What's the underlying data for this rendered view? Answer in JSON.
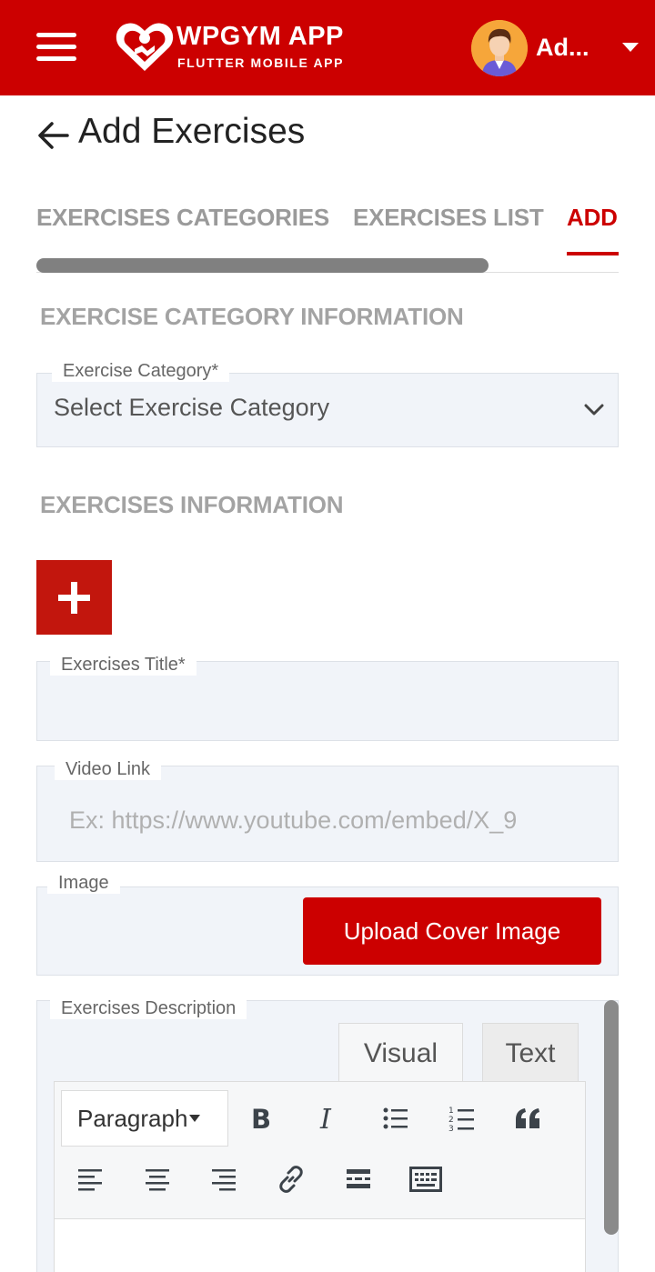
{
  "header": {
    "app_name": "WPGYM APP",
    "app_subtitle": "FLUTTER MOBILE APP",
    "user_name": "Ad...",
    "brand_color": "#cc0000"
  },
  "page": {
    "title": "Add Exercises"
  },
  "tabs": [
    {
      "label": "EXERCISES CATEGORIES",
      "active": false
    },
    {
      "label": "EXERCISES LIST",
      "active": false
    },
    {
      "label": "ADD",
      "active": true
    }
  ],
  "sections": {
    "category_heading": "EXERCISE CATEGORY INFORMATION",
    "exercises_heading": "EXERCISES INFORMATION"
  },
  "form": {
    "category": {
      "label": "Exercise Category*",
      "value": "Select Exercise Category"
    },
    "title": {
      "label": "Exercises Title*",
      "value": ""
    },
    "video": {
      "label": "Video Link",
      "placeholder": "Ex: https://www.youtube.com/embed/X_9"
    },
    "image": {
      "label": "Image",
      "button_label": "Upload Cover Image"
    },
    "description": {
      "label": "Exercises Description"
    }
  },
  "editor": {
    "tabs": [
      "Visual",
      "Text"
    ],
    "active_tab": "Visual",
    "format_select": "Paragraph",
    "toolbar_icons": [
      "bold-icon",
      "italic-icon",
      "bullet-list-icon",
      "numbered-list-icon",
      "blockquote-icon",
      "align-left-icon",
      "align-center-icon",
      "align-right-icon",
      "link-icon",
      "read-more-icon",
      "toolbar-toggle-icon"
    ]
  }
}
